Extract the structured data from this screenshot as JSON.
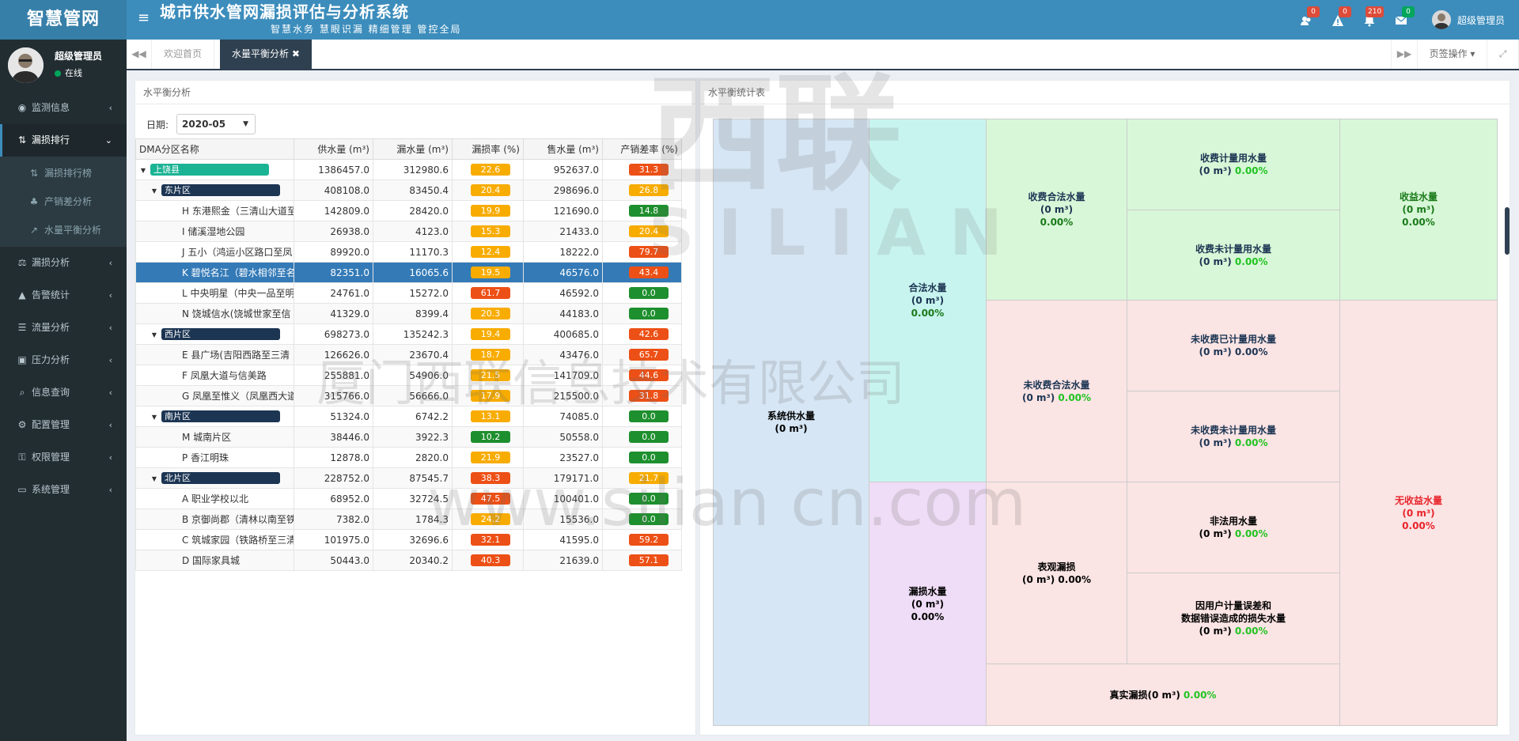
{
  "brand": "智慧管网",
  "system_title": "城市供水管网漏损评估与分析系统",
  "slogan": "智慧水务  慧眼识漏  精细管理  管控全局",
  "notifications": [
    {
      "icon": "users-icon",
      "count": "0",
      "color": "#dd4b39"
    },
    {
      "icon": "warning-icon",
      "count": "0",
      "color": "#dd4b39"
    },
    {
      "icon": "bell-icon",
      "count": "210",
      "color": "#dd4b39"
    },
    {
      "icon": "envelope-icon",
      "count": "0",
      "color": "#00a65a"
    }
  ],
  "user": {
    "name": "超级管理员",
    "status": "在线"
  },
  "menu": [
    {
      "label": "监测信息",
      "icon": "eye-icon",
      "glyph": "◉"
    },
    {
      "label": "漏损排行",
      "icon": "sort-icon",
      "glyph": "⇅",
      "active": true
    },
    {
      "label": "漏损分析",
      "icon": "balance-icon",
      "glyph": "⚖"
    },
    {
      "label": "告警统计",
      "icon": "warning-icon",
      "glyph": "▲"
    },
    {
      "label": "流量分析",
      "icon": "list-icon",
      "glyph": "☰"
    },
    {
      "label": "压力分析",
      "icon": "gauge-icon",
      "glyph": "▣"
    },
    {
      "label": "信息查询",
      "icon": "search-icon",
      "glyph": "⌕"
    },
    {
      "label": "配置管理",
      "icon": "cogs-icon",
      "glyph": "⚙"
    },
    {
      "label": "权限管理",
      "icon": "key-icon",
      "glyph": "⚿"
    },
    {
      "label": "系统管理",
      "icon": "desktop-icon",
      "glyph": "▭"
    }
  ],
  "submenu": [
    {
      "label": "漏损排行榜",
      "icon": "sort-icon",
      "glyph": "⇅"
    },
    {
      "label": "产销差分析",
      "icon": "sitemap-icon",
      "glyph": "♣"
    },
    {
      "label": "水量平衡分析",
      "icon": "chart-icon",
      "glyph": "↗"
    }
  ],
  "tabs": {
    "home": "欢迎首页",
    "current": "水量平衡分析",
    "page_ops": "页签操作"
  },
  "left_panel": {
    "title": "水平衡分析",
    "date_label": "日期:",
    "date_value": "2020-05"
  },
  "table": {
    "headers": [
      "DMA分区名称",
      "供水量 (m³)",
      "漏水量 (m³)",
      "漏损率 (%)",
      "售水量 (m³)",
      "产销差率 (%)"
    ],
    "rows": [
      {
        "level": 0,
        "name": "上饶县",
        "tag": "#1ab394",
        "supply": "1386457.0",
        "leak": "312980.6",
        "rate": "22.6",
        "rc": "y",
        "sold": "952637.0",
        "diff": "31.3",
        "dc": "r"
      },
      {
        "level": 1,
        "name": "东片区",
        "tag": "#1c3553",
        "supply": "408108.0",
        "leak": "83450.4",
        "rate": "20.4",
        "rc": "y",
        "sold": "298696.0",
        "diff": "26.8",
        "dc": "y"
      },
      {
        "level": 2,
        "name": "H 东港熙金（三清山大道至",
        "supply": "142809.0",
        "leak": "28420.0",
        "rate": "19.9",
        "rc": "y",
        "sold": "121690.0",
        "diff": "14.8",
        "dc": "g"
      },
      {
        "level": 2,
        "name": "I 储溪湿地公园",
        "supply": "26938.0",
        "leak": "4123.0",
        "rate": "15.3",
        "rc": "y",
        "sold": "21433.0",
        "diff": "20.4",
        "dc": "y"
      },
      {
        "level": 2,
        "name": "J 五小（鸿运小区路口至凤",
        "supply": "89920.0",
        "leak": "11170.3",
        "rate": "12.4",
        "rc": "y",
        "sold": "18222.0",
        "diff": "79.7",
        "dc": "r"
      },
      {
        "level": 2,
        "name": "K 碧悦名江（碧水相邻至名",
        "supply": "82351.0",
        "leak": "16065.6",
        "rate": "19.5",
        "rc": "y",
        "sold": "46576.0",
        "diff": "43.4",
        "dc": "r",
        "selected": true
      },
      {
        "level": 2,
        "name": "L 中央明星（中央一品至明",
        "supply": "24761.0",
        "leak": "15272.0",
        "rate": "61.7",
        "rc": "r",
        "sold": "46592.0",
        "diff": "0.0",
        "dc": "g"
      },
      {
        "level": 2,
        "name": "N 饶城信水(饶城世家至信",
        "supply": "41329.0",
        "leak": "8399.4",
        "rate": "20.3",
        "rc": "y",
        "sold": "44183.0",
        "diff": "0.0",
        "dc": "g"
      },
      {
        "level": 1,
        "name": "西片区",
        "tag": "#1c3553",
        "supply": "698273.0",
        "leak": "135242.3",
        "rate": "19.4",
        "rc": "y",
        "sold": "400685.0",
        "diff": "42.6",
        "dc": "r"
      },
      {
        "level": 2,
        "name": "E 县广场(吉阳西路至三清",
        "supply": "126626.0",
        "leak": "23670.4",
        "rate": "18.7",
        "rc": "y",
        "sold": "43476.0",
        "diff": "65.7",
        "dc": "r"
      },
      {
        "level": 2,
        "name": "F 凤凰大道与信美路",
        "supply": "255881.0",
        "leak": "54906.0",
        "rate": "21.5",
        "rc": "y",
        "sold": "141709.0",
        "diff": "44.6",
        "dc": "r"
      },
      {
        "level": 2,
        "name": "G 凤凰至惟义（凤凰西大道",
        "supply": "315766.0",
        "leak": "56666.0",
        "rate": "17.9",
        "rc": "y",
        "sold": "215500.0",
        "diff": "31.8",
        "dc": "r"
      },
      {
        "level": 1,
        "name": "南片区",
        "tag": "#1c3553",
        "supply": "51324.0",
        "leak": "6742.2",
        "rate": "13.1",
        "rc": "y",
        "sold": "74085.0",
        "diff": "0.0",
        "dc": "g"
      },
      {
        "level": 2,
        "name": "M 城南片区",
        "supply": "38446.0",
        "leak": "3922.3",
        "rate": "10.2",
        "rc": "g",
        "sold": "50558.0",
        "diff": "0.0",
        "dc": "g"
      },
      {
        "level": 2,
        "name": "P 香江明珠",
        "supply": "12878.0",
        "leak": "2820.0",
        "rate": "21.9",
        "rc": "y",
        "sold": "23527.0",
        "diff": "0.0",
        "dc": "g"
      },
      {
        "level": 1,
        "name": "北片区",
        "tag": "#1c3553",
        "supply": "228752.0",
        "leak": "87545.7",
        "rate": "38.3",
        "rc": "r",
        "sold": "179171.0",
        "diff": "21.7",
        "dc": "y"
      },
      {
        "level": 2,
        "name": "A 职业学校以北",
        "supply": "68952.0",
        "leak": "32724.5",
        "rate": "47.5",
        "rc": "r",
        "sold": "100401.0",
        "diff": "0.0",
        "dc": "g"
      },
      {
        "level": 2,
        "name": "B 京御尚郡（清林以南至铁",
        "supply": "7382.0",
        "leak": "1784.3",
        "rate": "24.2",
        "rc": "y",
        "sold": "15536.0",
        "diff": "0.0",
        "dc": "g"
      },
      {
        "level": 2,
        "name": "C 筑城家园（铁路桥至三清",
        "supply": "101975.0",
        "leak": "32696.6",
        "rate": "32.1",
        "rc": "r",
        "sold": "41595.0",
        "diff": "59.2",
        "dc": "r"
      },
      {
        "level": 2,
        "name": "D 国际家具城",
        "supply": "50443.0",
        "leak": "20340.2",
        "rate": "40.3",
        "rc": "r",
        "sold": "21639.0",
        "diff": "57.1",
        "dc": "r"
      }
    ]
  },
  "right_panel": {
    "title": "水平衡统计表"
  },
  "balance": {
    "system": {
      "label": "系统供水量",
      "unit": "(0 m³)"
    },
    "legal": {
      "label": "合法水量",
      "unit": "(0 m³)",
      "pct": "0.00%"
    },
    "loss": {
      "label": "漏损水量",
      "unit": "(0 m³)",
      "pct": "0.00%"
    },
    "billed": {
      "label": "收费合法水量",
      "unit": "(0 m³)",
      "pct": "0.00%"
    },
    "unbilled": {
      "label": "未收费合法水量",
      "unit": "(0 m³)",
      "pct": "0.00%"
    },
    "apparent": {
      "label": "表观漏损",
      "unit": "(0 m³)",
      "pct": "0.00%"
    },
    "real": {
      "label": "真实漏损(0 m³)",
      "pct": "0.00%"
    },
    "billed_metered": {
      "label": "收费计量用水量",
      "unit": "(0 m³)",
      "pct": "0.00%"
    },
    "billed_unmetered": {
      "label": "收费未计量用水量",
      "unit": "(0 m³)",
      "pct": "0.00%"
    },
    "unbilled_metered": {
      "label": "未收费已计量用水量",
      "unit": "(0 m³)",
      "pct": "0.00%"
    },
    "unbilled_unmetered": {
      "label": "未收费未计量用水量",
      "unit": "(0 m³)",
      "pct": "0.00%"
    },
    "illegal": {
      "label": "非法用水量",
      "unit": "(0 m³)",
      "pct": "0.00%"
    },
    "meter_error": {
      "label1": "因用户计量误差和",
      "label2": "数据错误造成的损失水量",
      "unit": "(0 m³)",
      "pct": "0.00%"
    },
    "revenue": {
      "label": "收益水量",
      "unit": "(0 m³)",
      "pct": "0.00%"
    },
    "nonrevenue": {
      "label": "无收益水量",
      "unit": "(0 m³)",
      "pct": "0.00%"
    }
  },
  "watermark": {
    "brand": "西联",
    "latin": "SILIAN",
    "company": "厦门西联信息技术有限公司",
    "url": "www.silian cn.com"
  }
}
